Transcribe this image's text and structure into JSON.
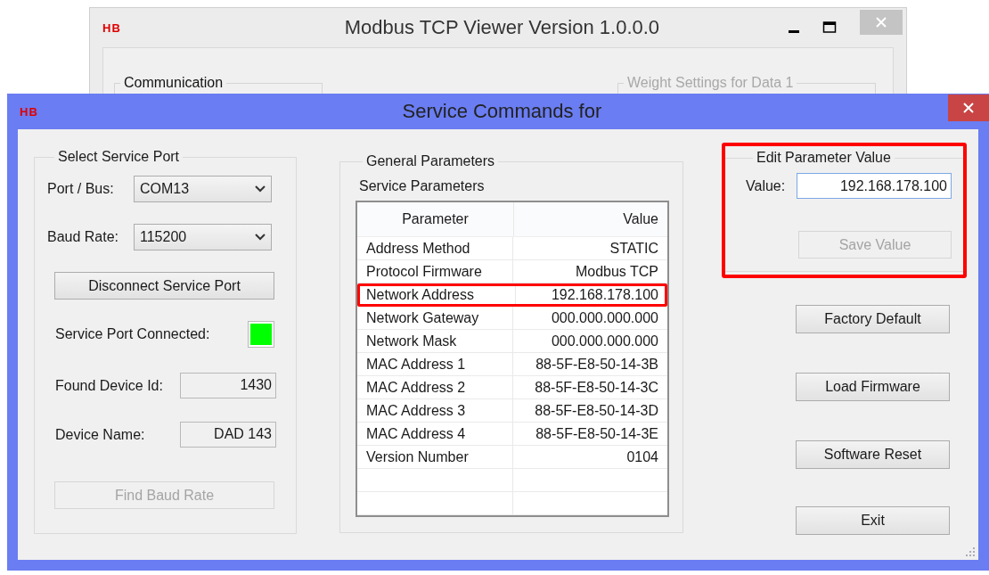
{
  "background_window": {
    "logo": "HB",
    "title": "Modbus TCP Viewer Version 1.0.0.0",
    "groups": [
      {
        "title": "Communication",
        "disabled": false
      },
      {
        "title": "Weight Settings for Data 1",
        "disabled": true
      }
    ]
  },
  "dialog": {
    "logo": "HB",
    "title": "Service Commands for"
  },
  "service_port": {
    "title": "Select Service Port",
    "selects": [
      {
        "label": "Port / Bus:",
        "value": "COM13"
      },
      {
        "label": "Baud Rate:",
        "value": "115200"
      }
    ],
    "disconnect_button": {
      "label": "Disconnect Service Port",
      "disabled": false
    },
    "connected": {
      "label": "Service Port Connected:",
      "on": true
    },
    "outputs": [
      {
        "label": "Found Device Id:",
        "value": "1430"
      },
      {
        "label": "Device Name:",
        "value": "DAD 143"
      }
    ],
    "find_baud_button": {
      "label": "Find Baud Rate",
      "disabled": true
    }
  },
  "general_parameters": {
    "title": "General Parameters",
    "subtitle": "Service Parameters",
    "columns": [
      "Parameter",
      "Value"
    ],
    "rows": [
      {
        "parameter": "Address Method",
        "value": "STATIC",
        "highlighted": false
      },
      {
        "parameter": "Protocol Firmware",
        "value": "Modbus TCP",
        "highlighted": false
      },
      {
        "parameter": "Network Address",
        "value": "192.168.178.100",
        "highlighted": true
      },
      {
        "parameter": "Network Gateway",
        "value": "000.000.000.000",
        "highlighted": false
      },
      {
        "parameter": "Network Mask",
        "value": "000.000.000.000",
        "highlighted": false
      },
      {
        "parameter": "MAC Address 1",
        "value": "88-5F-E8-50-14-3B",
        "highlighted": false
      },
      {
        "parameter": "MAC Address 2",
        "value": "88-5F-E8-50-14-3C",
        "highlighted": false
      },
      {
        "parameter": "MAC Address 3",
        "value": "88-5F-E8-50-14-3D",
        "highlighted": false
      },
      {
        "parameter": "MAC Address 4",
        "value": "88-5F-E8-50-14-3E",
        "highlighted": false
      },
      {
        "parameter": "Version Number",
        "value": "0104",
        "highlighted": false
      }
    ]
  },
  "edit_parameter": {
    "title": "Edit Parameter Value",
    "highlighted": true,
    "label": "Value:",
    "value": "192.168.178.100",
    "save_button": {
      "label": "Save Value",
      "disabled": true
    }
  },
  "buttons": [
    {
      "label": "Factory Default",
      "disabled": false
    },
    {
      "label": "Load Firmware",
      "disabled": false
    },
    {
      "label": "Software Reset",
      "disabled": false
    },
    {
      "label": "Exit",
      "disabled": false
    }
  ]
}
